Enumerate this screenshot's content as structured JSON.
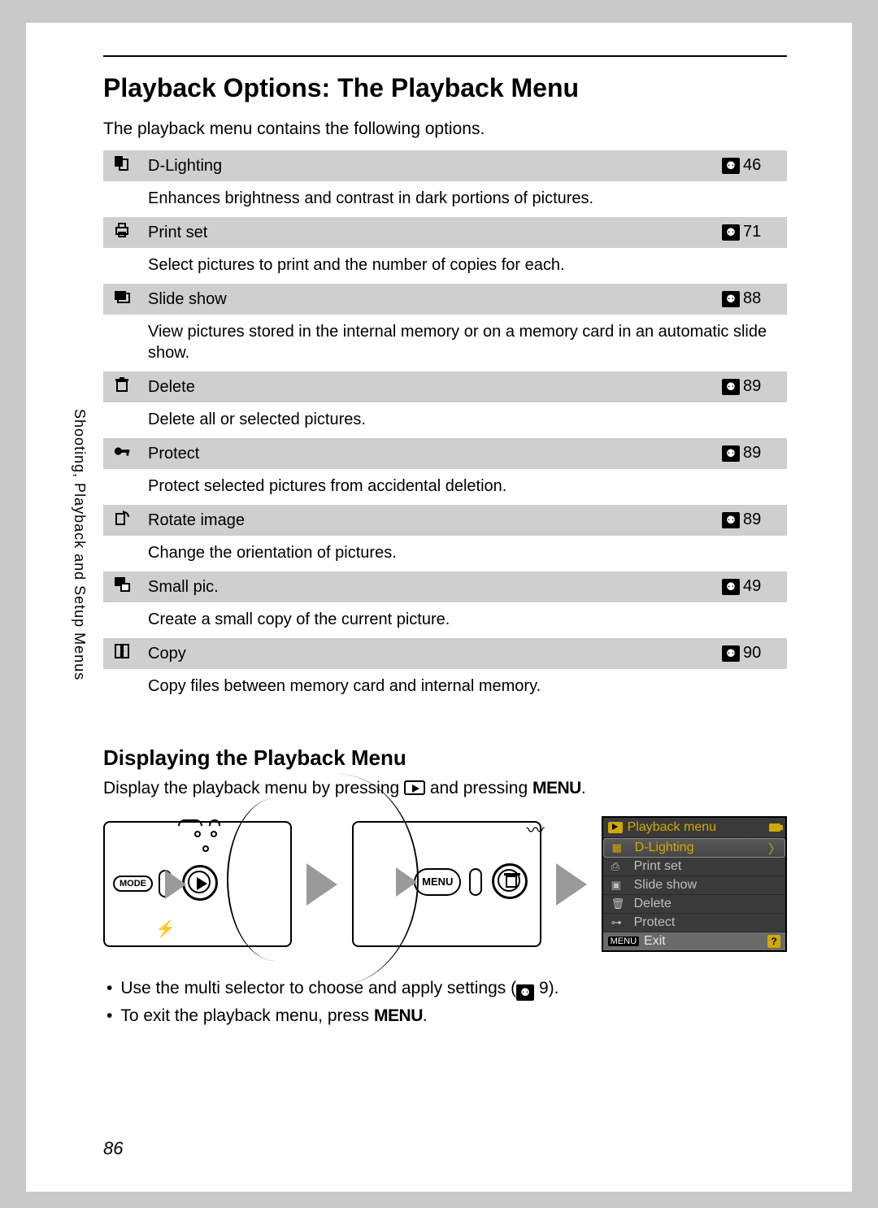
{
  "page_number": "86",
  "sidebar": "Shooting, Playback and Setup Menus",
  "title": "Playback Options: The Playback Menu",
  "intro": "The playback menu contains the following options.",
  "options": [
    {
      "icon": "d-lighting",
      "name": "D-Lighting",
      "page": "46",
      "desc": "Enhances brightness and contrast in dark portions of pictures."
    },
    {
      "icon": "print",
      "name": "Print set",
      "page": "71",
      "desc": "Select pictures to print and the number of copies for each."
    },
    {
      "icon": "slideshow",
      "name": "Slide show",
      "page": "88",
      "desc": "View pictures stored in the internal memory or on a memory card in an automatic slide show."
    },
    {
      "icon": "trash",
      "name": "Delete",
      "page": "89",
      "desc": "Delete all or selected pictures."
    },
    {
      "icon": "protect",
      "name": "Protect",
      "page": "89",
      "desc": "Protect selected pictures from accidental deletion."
    },
    {
      "icon": "rotate",
      "name": "Rotate image",
      "page": "89",
      "desc": "Change the orientation of pictures."
    },
    {
      "icon": "smallpic",
      "name": "Small pic.",
      "page": "49",
      "desc": "Create a small copy of the current picture."
    },
    {
      "icon": "copy",
      "name": "Copy",
      "page": "90",
      "desc": "Copy files between memory card and internal memory."
    }
  ],
  "subheading": "Displaying the Playback Menu",
  "display_line_pre": "Display the playback menu by pressing ",
  "display_line_mid": " and pressing ",
  "display_line_menu": "MENU",
  "display_line_post": ".",
  "camera1": {
    "mode": "MODE"
  },
  "camera2": {
    "menu": "MENU"
  },
  "lcd": {
    "title": "Playback menu",
    "items": [
      "D-Lighting",
      "Print set",
      "Slide show",
      "Delete",
      "Protect"
    ],
    "exit_menu": "MENU",
    "exit": "Exit"
  },
  "bullets": {
    "b1_pre": "Use the multi selector to choose and apply settings (",
    "b1_page": "9",
    "b1_post": ").",
    "b2_pre": "To exit the playback menu, press ",
    "b2_menu": "MENU",
    "b2_post": "."
  }
}
